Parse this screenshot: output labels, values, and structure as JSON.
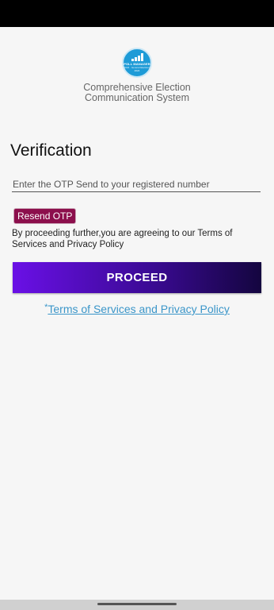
{
  "header": {
    "logo_line1": "POLL MANAGER",
    "logo_line2": "2024 · General Elections",
    "logo_line3": "2024",
    "app_title_line1": "Comprehensive Election",
    "app_title_line2": "Communication System"
  },
  "verification": {
    "heading": "Verification",
    "otp_placeholder": "Enter the OTP Send to your registered number",
    "resend_label": "Resend OTP",
    "consent_text": "By proceeding further,you are agreeing to our Terms of Services and Privacy Policy",
    "proceed_label": "PROCEED",
    "terms_marker": "*",
    "terms_link": "Terms of Services and Privacy Policy"
  },
  "colors": {
    "resend_bg": "#8c0f4c",
    "proceed_gradient_start": "#6a10e6",
    "proceed_gradient_end": "#14053f",
    "link": "#3b96c9",
    "logo_blue": "#1e9bd7"
  }
}
